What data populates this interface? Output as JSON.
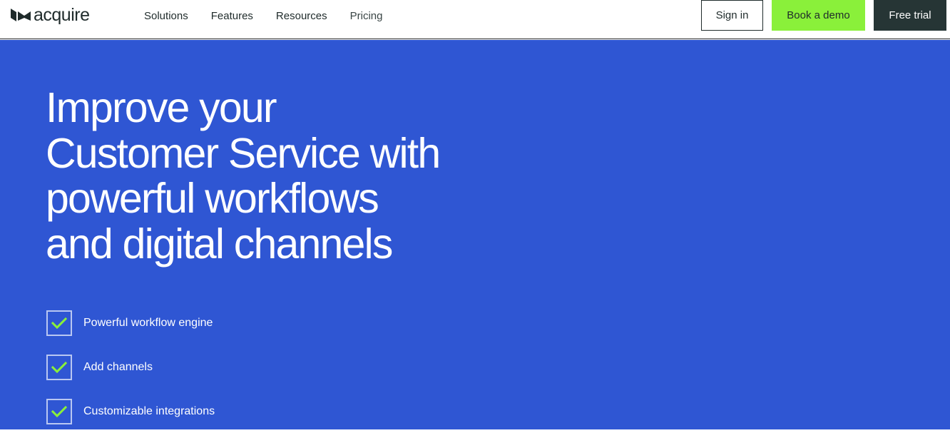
{
  "brand": {
    "name": "acquire",
    "icon": "acquire-logo-icon",
    "text_color": "#1f2b2b"
  },
  "nav": {
    "links": [
      {
        "label": "Solutions"
      },
      {
        "label": "Features"
      },
      {
        "label": "Resources"
      },
      {
        "label": "Pricing"
      }
    ]
  },
  "actions": {
    "sign_in": "Sign in",
    "book_demo": "Book a demo",
    "free_trial": "Free trial"
  },
  "hero": {
    "headline_lines": [
      "Improve your",
      "Customer Service with",
      "powerful workflows",
      "and digital channels"
    ],
    "features": [
      {
        "label": "Powerful workflow engine",
        "icon": "check-icon"
      },
      {
        "label": "Add channels",
        "icon": "check-icon"
      },
      {
        "label": "Customizable integrations",
        "icon": "check-icon"
      }
    ]
  },
  "colors": {
    "hero_background": "#2f56d3",
    "demo_button": "#8af03a",
    "trial_button": "#263535",
    "check": "#8af03a"
  }
}
